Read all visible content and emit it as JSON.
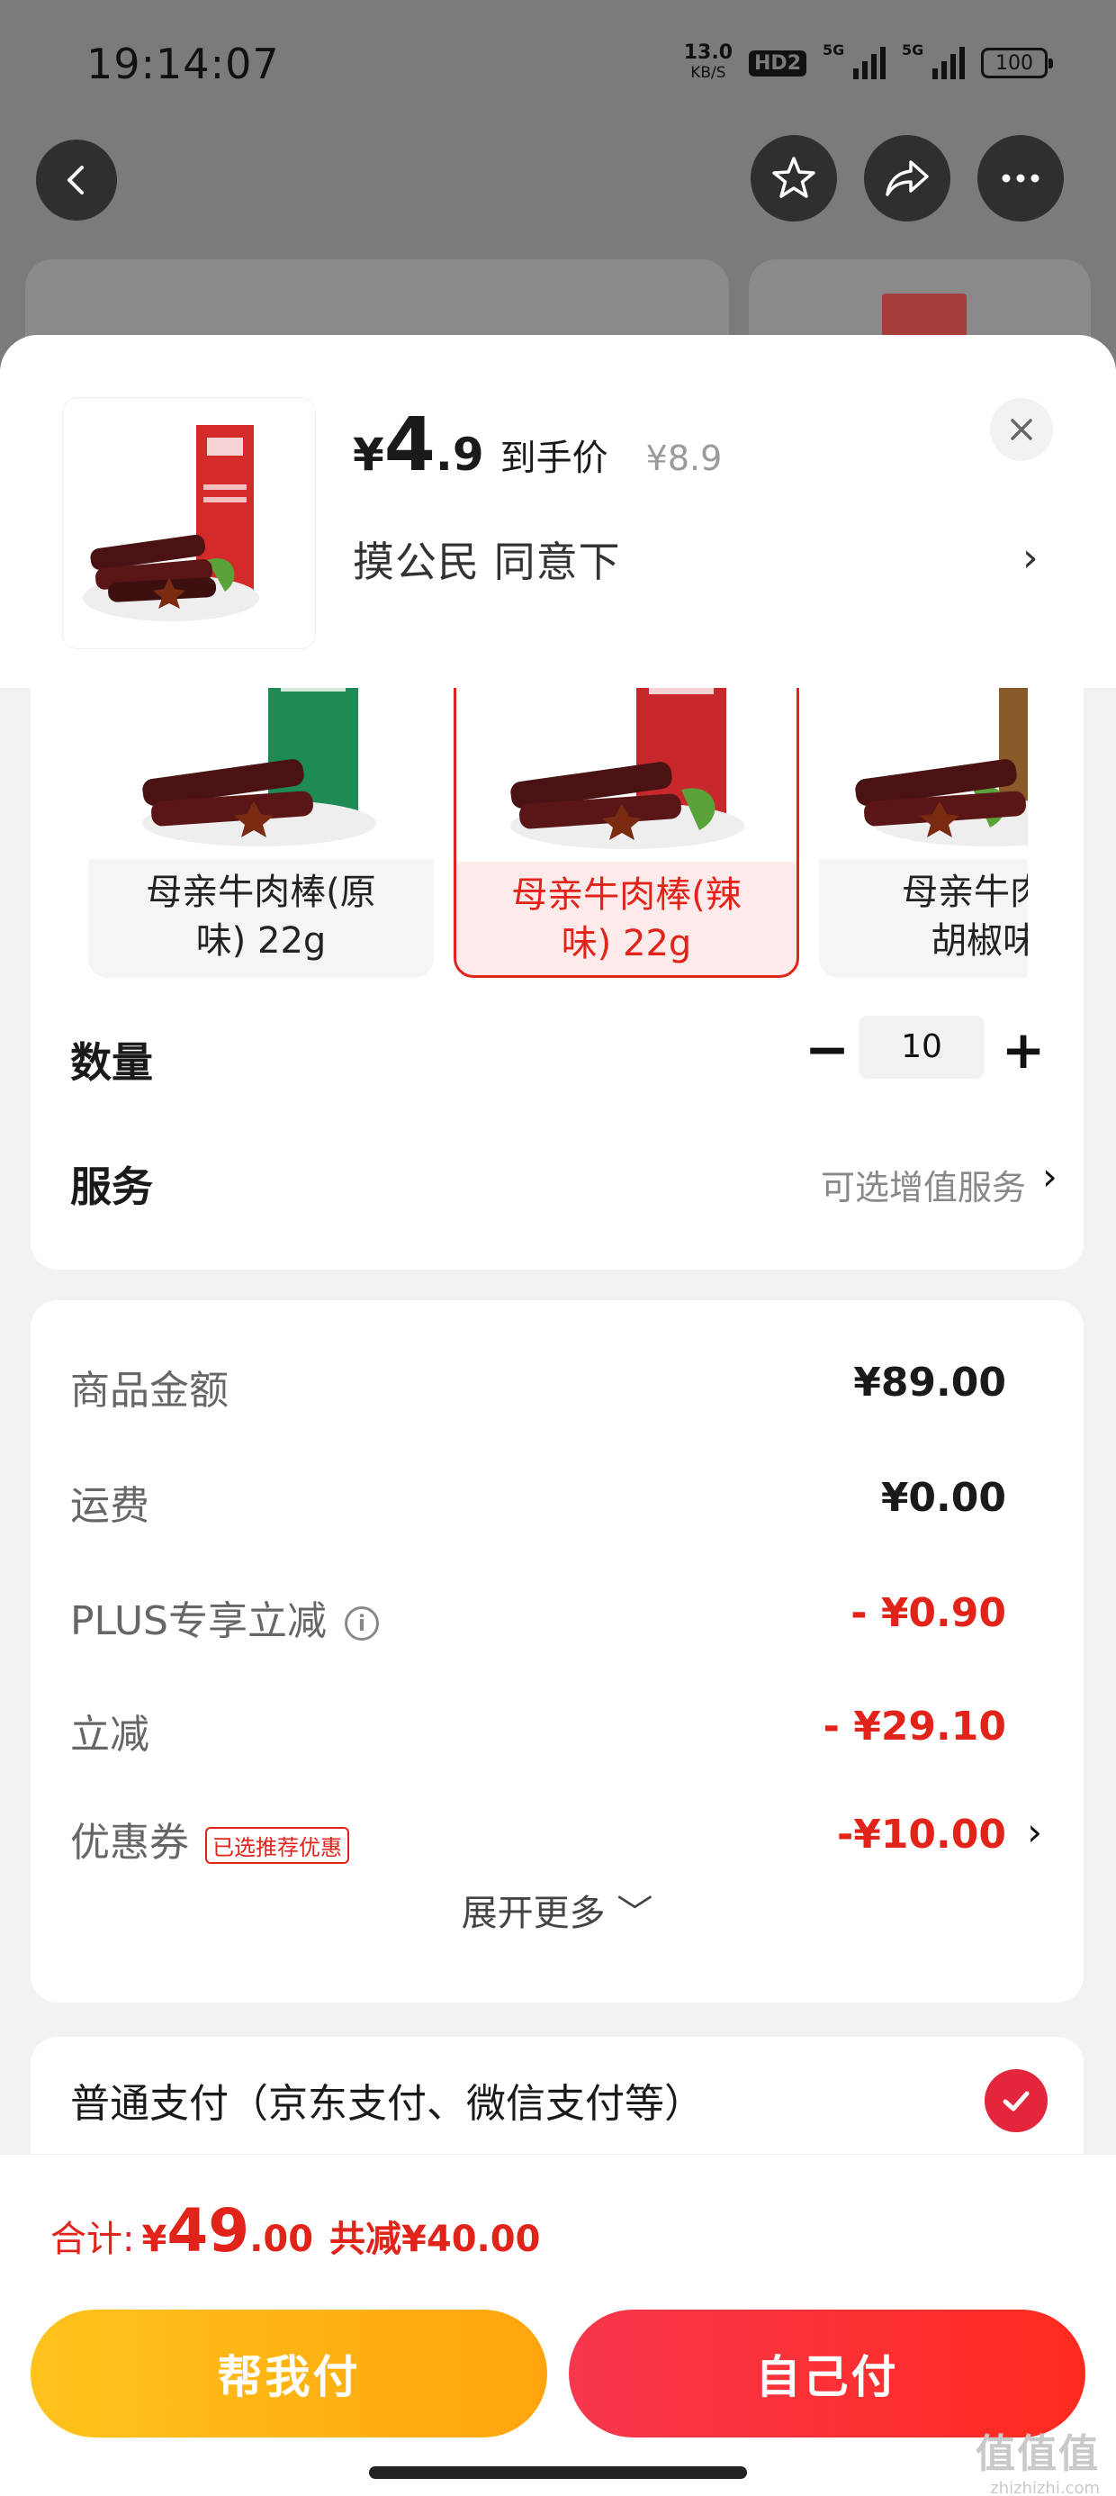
{
  "status_bar": {
    "time": "19:14:07",
    "net_speed_value": "13.0",
    "net_speed_unit": "KB/S",
    "hd_badge": "HD2",
    "signal1_label": "5G",
    "signal2_label": "5G",
    "battery": "100"
  },
  "nav": {
    "back_icon": "chevron-left-icon",
    "favorite_icon": "star-icon",
    "share_icon": "share-icon",
    "more_icon": "more-icon"
  },
  "header": {
    "price_symbol": "¥",
    "price_int": "4",
    "price_dec": ".9",
    "price_tag": "到手价",
    "original_price": "¥8.9",
    "selected_spec": "摸公民  同意下",
    "spec_chevron": "›",
    "close_icon": "close-icon"
  },
  "variants": [
    {
      "label_line1": "母亲牛肉棒(原",
      "label_line2": "味) 22g",
      "selected": false,
      "pack_color": "#1e8a54"
    },
    {
      "label_line1": "母亲牛肉棒(辣",
      "label_line2": "味) 22g",
      "selected": true,
      "pack_color": "#c8282c"
    },
    {
      "label_line1": "母亲牛肉棒",
      "label_line2": "胡椒味)",
      "selected": false,
      "pack_color": "#8b5a2b"
    }
  ],
  "quantity": {
    "label": "数量",
    "minus": "−",
    "value": "10",
    "plus": "+"
  },
  "service": {
    "label": "服务",
    "value": "可选增值服务",
    "chevron": "›"
  },
  "price_details": {
    "rows": [
      {
        "label": "商品金额",
        "value": "¥89.00"
      },
      {
        "label": "运费",
        "value": "¥0.00"
      },
      {
        "label": "PLUS专享立减",
        "value": "- ¥0.90"
      },
      {
        "label": "立减",
        "value": "- ¥29.10"
      },
      {
        "label": "优惠券",
        "badge": "已选推荐优惠",
        "value": "-¥10.00"
      }
    ],
    "info_icon": "i",
    "expand_more": "展开更多 ﹀"
  },
  "payment": {
    "label": "普通支付（京东支付、微信支付等）",
    "checked": true
  },
  "footer": {
    "total_prefix": "合计:",
    "total_symbol": "¥",
    "total_int": "49",
    "total_dec": ".00",
    "total_saved": "共减¥40.00",
    "help_pay": "帮我付",
    "self_pay": "自己付"
  },
  "watermark": {
    "big": "值值值",
    "small": "zhizhizhi.com"
  },
  "colors": {
    "accent_red": "#e2231a",
    "help_pay_yellow": "#ffb414",
    "check_red": "#e3263b"
  }
}
